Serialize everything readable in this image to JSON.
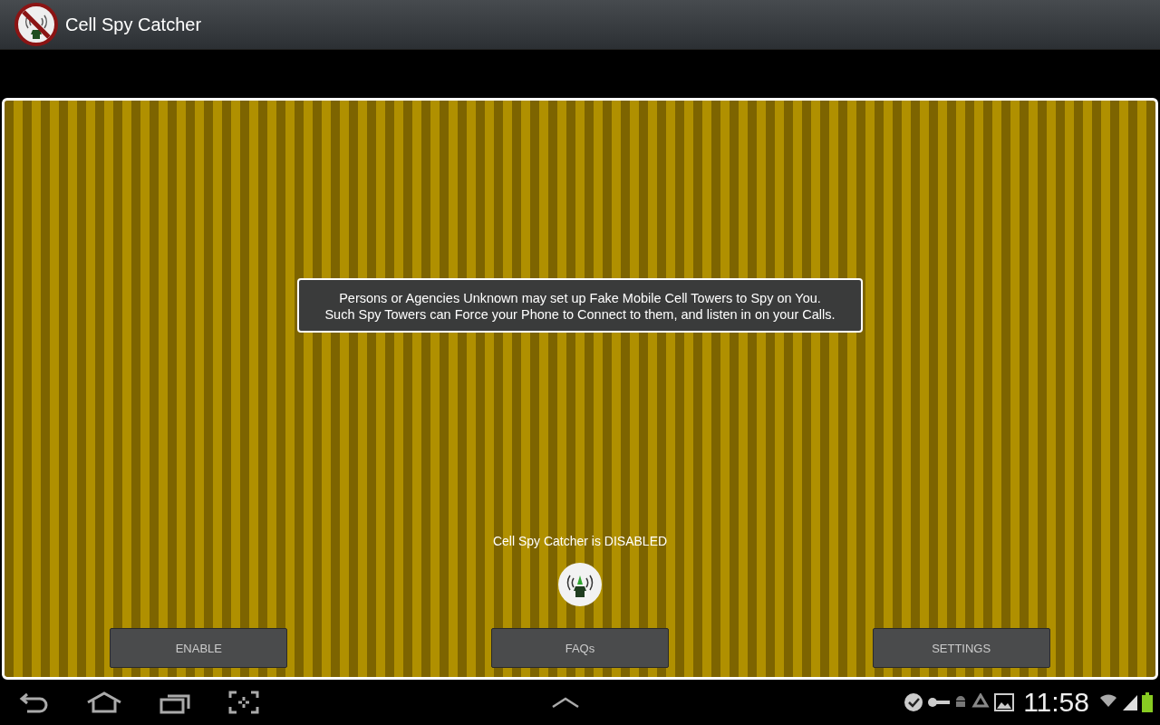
{
  "action_bar": {
    "title": "Cell Spy Catcher"
  },
  "message": {
    "lines": [
      "Persons or Agencies Unknown may set up Fake Mobile Cell Towers to Spy on You.",
      "Such Spy Towers can Force your Phone to Connect to them, and listen in on your Calls."
    ]
  },
  "status_text": "Cell Spy Catcher is DISABLED",
  "buttons": [
    {
      "label": "ENABLE"
    },
    {
      "label": "FAQs"
    },
    {
      "label": "SETTINGS"
    }
  ],
  "system_bar": {
    "time": "11:58"
  }
}
